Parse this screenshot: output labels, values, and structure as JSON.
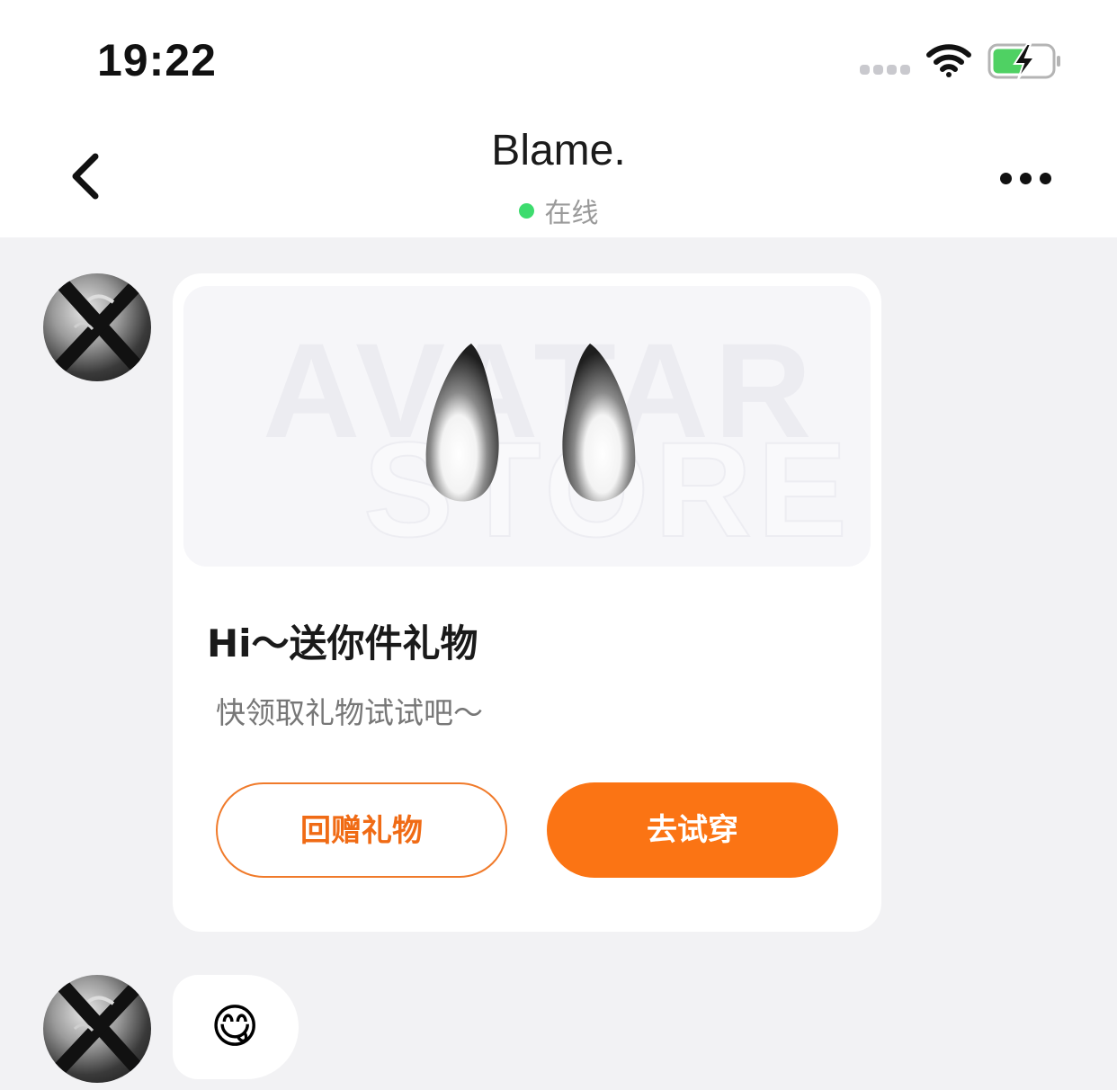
{
  "status_bar": {
    "time": "19:22",
    "signal_icon": "cell-signal-icon",
    "wifi_icon": "wifi-icon",
    "battery_icon": "battery-charging-icon"
  },
  "header": {
    "back_icon": "chevron-left-icon",
    "title": "Blame.",
    "online_status": "在线",
    "status_color": "#3ddc6e",
    "more_icon": "more-dots-icon"
  },
  "messages": [
    {
      "type": "gift-card",
      "image_watermark": [
        "AVATAR",
        "STORE"
      ],
      "title": "Hi～送你件礼物",
      "subtitle": "快领取礼物试试吧～",
      "buttons": {
        "return_gift": "回赠礼物",
        "try_on": "去试穿"
      }
    },
    {
      "type": "emoji",
      "content": "😋"
    }
  ],
  "colors": {
    "accent": "#fb7414",
    "background": "#f2f2f4",
    "card": "#ffffff"
  }
}
